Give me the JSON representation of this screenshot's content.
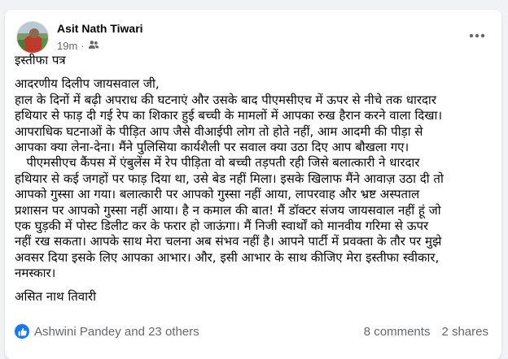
{
  "post": {
    "author": "Asit Nath Tiwari",
    "time": "19m",
    "dot": "·",
    "lines": [
      "इस्तीफा पत्र",
      "",
      "आदरणीय दिलीप जायसवाल जी,",
      "हाल के दिनों में बढ़ी अपराध की घटनाएं और उसके बाद पीएमसीएच में ऊपर से नीचे तक धारदार",
      "हथियार से फाड़ दी गई रेप का शिकार हुई बच्ची के मामलों में आपका रुख हैरान करने वाला दिखा।",
      "आपराधिक घटनाओं के पीड़ित आप जैसे वीआईपी लोग तो होते नहीं, आम आदमी की पीड़ा से",
      "आपका क्या लेना-देना। मैंने पुलिसिया कार्यशैली पर सवाल क्या उठा दिए आप बौखला गए।",
      "   पीएमसीएच कैंपस में एंबुलेंस में रेप पीड़िता वो बच्ची तड़पती रही जिसे बलात्कारी ने धारदार",
      "हथियार से कई जगहों पर फाड़ दिया था, उसे बेड नहीं मिला। इसके खिलाफ मैंने आवाज़ उठा दी तो",
      "आपको गुस्सा आ गया। बलात्कारी पर आपको गुस्सा नहीं आया, लापरवाह और भ्रष्ट अस्पताल",
      "प्रशासन पर आपको गुस्सा नहीं आया। है न कमाल की बात! मैं डॉक्टर संजय जायसवाल नहीं हूं जो",
      "एक घुड़की में पोस्ट डिलीट कर के फरार हो जाऊंगा। मैं निजी स्वार्थों को मानवीय गरिमा से ऊपर",
      "नहीं रख सकता। आपके साथ मेरा चलना अब संभव नहीं है। आपने पार्टी में प्रवक्ता के तौर पर मुझे",
      "अवसर दिया इसके लिए आपका आभार। और, इसी आभार के साथ कीजिए मेरा इस्तीफा स्वीकार,",
      "नमस्कार।",
      "",
      "असित नाथ तिवारी"
    ]
  },
  "engagement": {
    "reactions_text": "Ashwini Pandey and 23 others",
    "comments": "8 comments",
    "shares": "2 shares"
  },
  "icons": {
    "more": "more-options-icon",
    "audience": "friends-audience-icon",
    "like": "like-reaction-icon"
  },
  "colors": {
    "accent": "#1877f2",
    "secondary_text": "#65676b",
    "background": "#f0f2f5"
  }
}
